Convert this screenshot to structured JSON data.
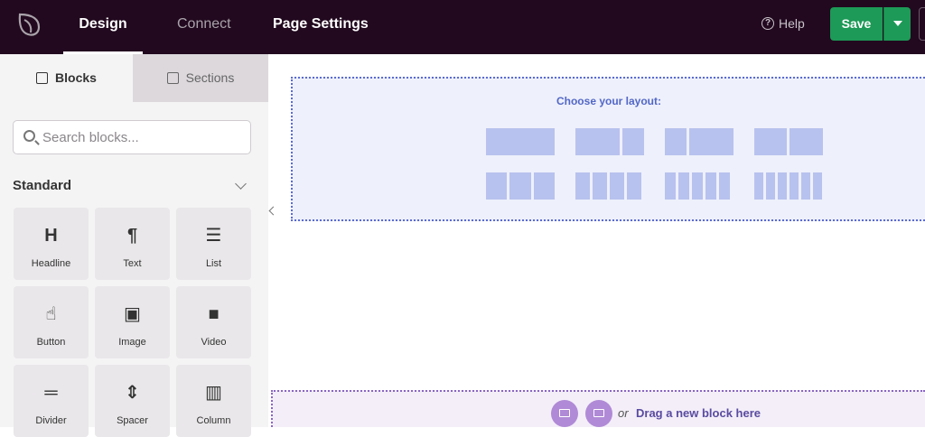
{
  "topbar": {
    "tabs": [
      {
        "label": "Design"
      },
      {
        "label": "Connect"
      },
      {
        "label": "Page Settings"
      }
    ],
    "help_label": "Help",
    "save_label": "Save",
    "brand_color": "#22091f",
    "save_color": "#1d9a57"
  },
  "sidebar": {
    "tabs": [
      {
        "label": "Blocks",
        "icon": "add-block-icon"
      },
      {
        "label": "Sections",
        "icon": "sections-icon"
      }
    ],
    "search_placeholder": "Search blocks...",
    "section_title": "Standard",
    "blocks": [
      {
        "label": "Headline",
        "icon": "headline-icon",
        "glyph": "H"
      },
      {
        "label": "Text",
        "icon": "paragraph-icon",
        "glyph": "¶"
      },
      {
        "label": "List",
        "icon": "list-icon",
        "glyph": "☰"
      },
      {
        "label": "Button",
        "icon": "pointer-hand-icon",
        "glyph": "☝"
      },
      {
        "label": "Image",
        "icon": "image-icon",
        "glyph": "▣"
      },
      {
        "label": "Video",
        "icon": "video-camera-icon",
        "glyph": "■"
      },
      {
        "label": "Divider",
        "icon": "divider-icon",
        "glyph": "═"
      },
      {
        "label": "Spacer",
        "icon": "spacer-icon",
        "glyph": "⇕"
      },
      {
        "label": "Column",
        "icon": "columns-icon",
        "glyph": "▥"
      }
    ]
  },
  "canvas": {
    "layout_title": "Choose your layout:",
    "drop_or": "or",
    "drop_label": "Drag a new block here",
    "accent": "#5267c7"
  }
}
